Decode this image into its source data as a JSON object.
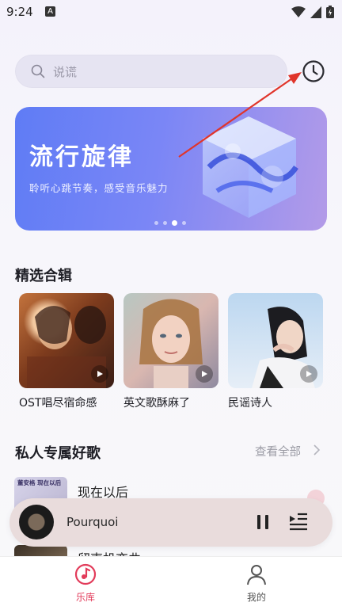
{
  "status": {
    "time": "9:24",
    "notification_letter": "A"
  },
  "search": {
    "placeholder": "说谎"
  },
  "banner": {
    "title": "流行旋律",
    "subtitle": "聆听心跳节奏，感受音乐魅力",
    "page_count": 4,
    "active_page": 2
  },
  "featured": {
    "title": "精选合辑",
    "albums": [
      {
        "title": "OST唱尽宿命感"
      },
      {
        "title": "英文歌酥麻了"
      },
      {
        "title": "民谣诗人"
      }
    ]
  },
  "personal": {
    "title": "私人专属好歌",
    "see_all": "查看全部",
    "songs": [
      {
        "title": "现在以后",
        "thumb_text": "董安格 现在以后"
      },
      {
        "title": "留声机恋曲"
      }
    ]
  },
  "player": {
    "title": "Pourquoi"
  },
  "tabs": [
    {
      "label": "乐库",
      "active": true
    },
    {
      "label": "我的",
      "active": false
    }
  ],
  "colors": {
    "accent": "#e23b5a",
    "banner_start": "#5f7cf5",
    "banner_end": "#b39be8",
    "annotation_arrow": "#e0352b"
  }
}
